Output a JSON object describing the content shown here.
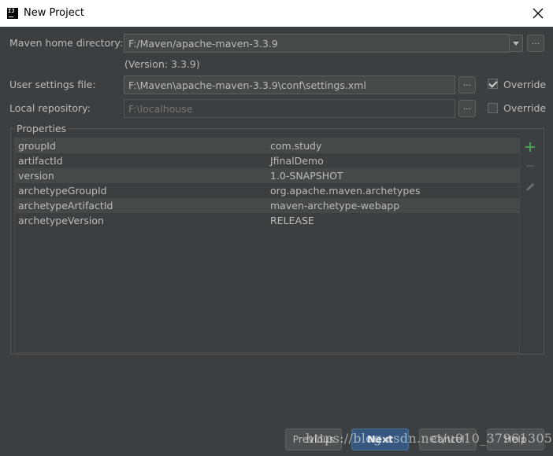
{
  "window": {
    "title": "New Project"
  },
  "maven_home": {
    "label": "Maven home directory:",
    "value": "F:/Maven/apache-maven-3.3.9",
    "version": "(Version: 3.3.9)"
  },
  "user_settings": {
    "label": "User settings file:",
    "value": "F:\\Maven\\apache-maven-3.3.9\\conf\\settings.xml",
    "override_label": "Override",
    "override_checked": true
  },
  "local_repo": {
    "label": "Local repository:",
    "value": "F:\\localhouse",
    "override_label": "Override",
    "override_checked": false
  },
  "browse_label": "...",
  "properties": {
    "title": "Properties",
    "rows": [
      {
        "key": "groupId",
        "value": "com.study"
      },
      {
        "key": "artifactId",
        "value": "JfinalDemo"
      },
      {
        "key": "version",
        "value": "1.0-SNAPSHOT"
      },
      {
        "key": "archetypeGroupId",
        "value": "org.apache.maven.archetypes"
      },
      {
        "key": "archetypeArtifactId",
        "value": "maven-archetype-webapp"
      },
      {
        "key": "archetypeVersion",
        "value": "RELEASE"
      }
    ]
  },
  "buttons": {
    "previous": "Previous",
    "next": "Next",
    "cancel": "Cancel",
    "help": "Help"
  },
  "watermark": "https://blog.csdn.net/u010_37961305",
  "colors": {
    "background": "#3c3f41",
    "field": "#45494a",
    "primary_button": "#365880",
    "add_icon": "#499c54"
  },
  "icons": [
    "app-logo-icon",
    "close-icon",
    "dropdown-arrow-icon",
    "add-icon",
    "remove-icon",
    "edit-icon"
  ]
}
